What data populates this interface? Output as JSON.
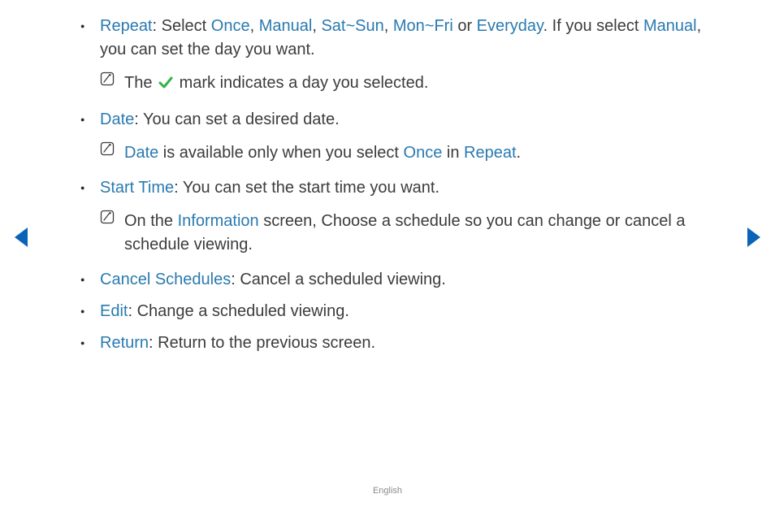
{
  "bullets": {
    "repeat": {
      "label": "Repeat",
      "pre": ": Select ",
      "opts": [
        "Once",
        "Manual",
        "Sat~Sun",
        "Mon~Fri",
        "Everyday"
      ],
      "sep": ", ",
      "sep_last": " or ",
      "post1": ". If you select ",
      "opt_manual": "Manual",
      "post2": ", you can set the day you want.",
      "note_pre": "The ",
      "note_post": " mark indicates a day you selected."
    },
    "date": {
      "label": "Date",
      "text": ": You can set a desired date.",
      "note_kw1": "Date",
      "note_mid": " is available only when you select ",
      "note_kw2": "Once",
      "note_mid2": " in ",
      "note_kw3": "Repeat",
      "note_end": "."
    },
    "start": {
      "label": "Start Time",
      "text": ": You can set the start time you want.",
      "note_pre": "On the ",
      "note_kw": "Information",
      "note_post": " screen, Choose a schedule so you can change or cancel a schedule viewing."
    },
    "cancel": {
      "label": "Cancel Schedules",
      "text": ": Cancel a scheduled viewing."
    },
    "edit": {
      "label": "Edit",
      "text": ": Change a scheduled viewing."
    },
    "return": {
      "label": "Return",
      "text": ": Return to the previous screen."
    }
  },
  "footer": {
    "lang": "English"
  },
  "colors": {
    "keyword": "#2a7ab0",
    "nav": "#0a63b6",
    "check": "#36b24a"
  }
}
